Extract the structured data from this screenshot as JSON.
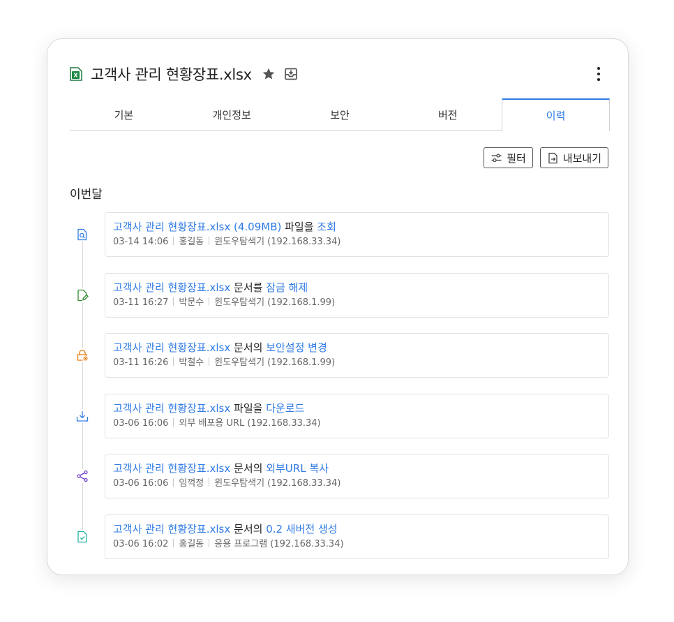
{
  "header": {
    "file_icon": "excel-file-icon",
    "title": "고객사 관리 현황장표.xlsx",
    "star_icon": "star-icon",
    "inbox_icon": "inbox-icon",
    "more_icon": "more-vertical-icon"
  },
  "tabs": [
    {
      "label": "기본",
      "active": false
    },
    {
      "label": "개인정보",
      "active": false
    },
    {
      "label": "보안",
      "active": false
    },
    {
      "label": "버전",
      "active": false
    },
    {
      "label": "이력",
      "active": true
    }
  ],
  "actions": {
    "filter_label": "필터",
    "export_label": "내보내기"
  },
  "section_label": "이번달",
  "colors": {
    "accent": "#2f7be5",
    "view": "#2f7be5",
    "unlock": "#2e8b2e",
    "security": "#e8780c",
    "download": "#2f7be5",
    "share": "#6b3fc6",
    "version": "#1fb3a3"
  },
  "events": [
    {
      "icon": "file-search-icon",
      "file": "고객사 관리 현황장표.xlsx (4.09MB)",
      "verb": " 파일을 ",
      "action": "조회",
      "time": "03-14 14:06",
      "user": "홍길동",
      "client": "윈도우탐색기 (192.168.33.34)"
    },
    {
      "icon": "file-edit-icon",
      "file": "고객사 관리 현황장표.xlsx",
      "verb": " 문서를 ",
      "action": "잠금 해제",
      "time": "03-11 16:27",
      "user": "박문수",
      "client": "윈도우탐색기 (192.168.1.99)"
    },
    {
      "icon": "lock-settings-icon",
      "file": "고객사 관리 현황장표.xlsx",
      "verb": " 문서의 ",
      "action": "보안설정 변경",
      "time": "03-11 16:26",
      "user": "박철수",
      "client": "윈도우탐색기 (192.168.1.99)"
    },
    {
      "icon": "download-icon",
      "file": "고객사 관리 현황장표.xlsx",
      "verb": " 파일을 ",
      "action": "다운로드",
      "time": "03-06 16:06",
      "user": "외부 배포용 URL (192.168.33.34)",
      "client": ""
    },
    {
      "icon": "share-icon",
      "file": "고객사 관리 현황장표.xlsx",
      "verb": " 문서의 ",
      "action": "외부URL 복사",
      "time": "03-06 16:06",
      "user": "임꺽정",
      "client": "윈도우탐색기 (192.168.33.34)"
    },
    {
      "icon": "file-check-icon",
      "file": "고객사 관리 현황장표.xlsx",
      "verb": " 문서의 ",
      "action": "0.2 새버전 생성",
      "time": "03-06 16:02",
      "user": "홍길동",
      "client": "응용 프로그램 (192.168.33.34)"
    }
  ]
}
